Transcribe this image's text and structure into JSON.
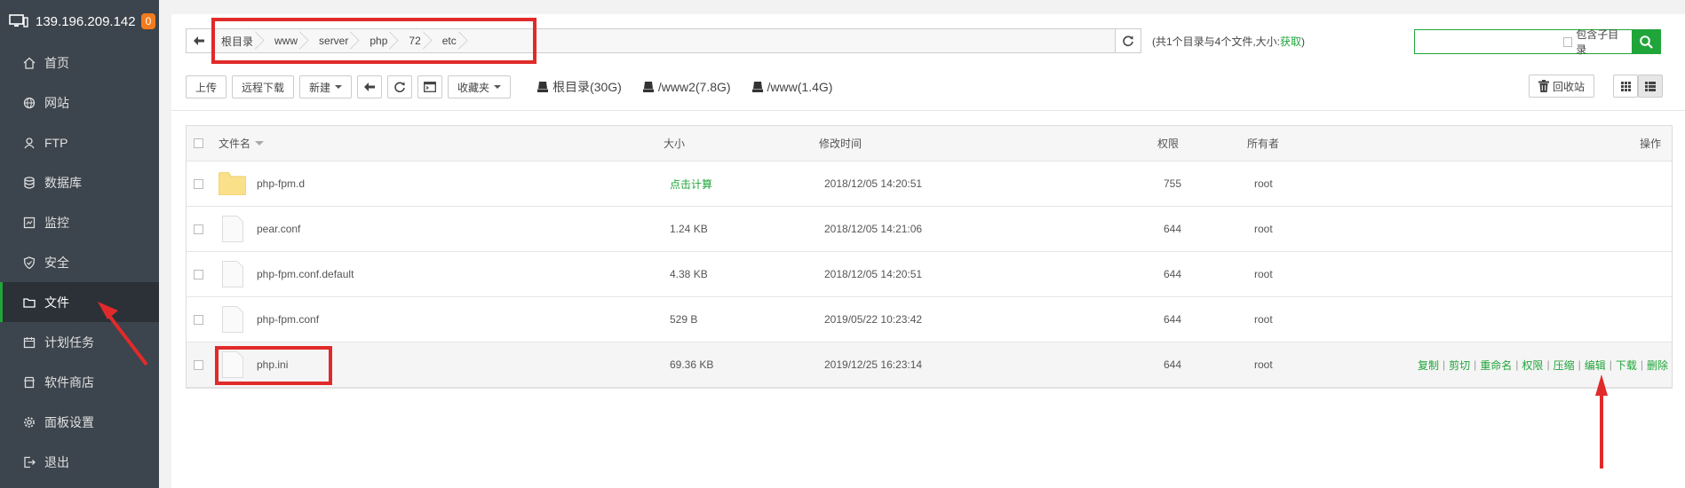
{
  "sidebar": {
    "ip": "139.196.209.142",
    "badge": "0",
    "items": [
      {
        "label": "首页",
        "icon": "home-icon"
      },
      {
        "label": "网站",
        "icon": "globe-icon"
      },
      {
        "label": "FTP",
        "icon": "ftp-icon"
      },
      {
        "label": "数据库",
        "icon": "database-icon"
      },
      {
        "label": "监控",
        "icon": "monitor-icon"
      },
      {
        "label": "安全",
        "icon": "shield-icon"
      },
      {
        "label": "文件",
        "icon": "folder-icon",
        "active": true
      },
      {
        "label": "计划任务",
        "icon": "calendar-icon"
      },
      {
        "label": "软件商店",
        "icon": "store-icon"
      },
      {
        "label": "面板设置",
        "icon": "gear-icon"
      },
      {
        "label": "退出",
        "icon": "logout-icon"
      }
    ]
  },
  "breadcrumb": [
    "根目录",
    "www",
    "server",
    "php",
    "72",
    "etc"
  ],
  "summary": {
    "text": "(共1个目录与4个文件,大小:",
    "link": "获取",
    "end": ")"
  },
  "search": {
    "placeholder": "",
    "sub_label": "包含子目录"
  },
  "toolbar": {
    "upload": "上传",
    "remote_download": "远程下载",
    "new": "新建",
    "favorites": "收藏夹",
    "disks": [
      "根目录(30G)",
      "/www2(7.8G)",
      "/www(1.4G)"
    ],
    "recycle": "回收站"
  },
  "table": {
    "headers": {
      "name": "文件名",
      "size": "大小",
      "mtime": "修改时间",
      "perm": "权限",
      "owner": "所有者",
      "ops": "操作"
    },
    "rows": [
      {
        "name": "php-fpm.d",
        "type": "folder",
        "size": "点击计算",
        "mtime": "2018/12/05 14:20:51",
        "perm": "755",
        "owner": "root"
      },
      {
        "name": "pear.conf",
        "type": "file",
        "size": "1.24 KB",
        "mtime": "2018/12/05 14:21:06",
        "perm": "644",
        "owner": "root"
      },
      {
        "name": "php-fpm.conf.default",
        "type": "file",
        "size": "4.38 KB",
        "mtime": "2018/12/05 14:20:51",
        "perm": "644",
        "owner": "root"
      },
      {
        "name": "php-fpm.conf",
        "type": "file",
        "size": "529 B",
        "mtime": "2019/05/22 10:23:42",
        "perm": "644",
        "owner": "root"
      },
      {
        "name": "php.ini",
        "type": "file",
        "size": "69.36 KB",
        "mtime": "2019/12/25 16:23:14",
        "perm": "644",
        "owner": "root",
        "highlight": true
      }
    ],
    "ops": [
      "复制",
      "剪切",
      "重命名",
      "权限",
      "压缩",
      "编辑",
      "下载",
      "删除"
    ]
  },
  "colors": {
    "sidebar": "#3c444d",
    "accent": "#20a53a",
    "annotation": "#e12a2a",
    "folder": "#fce38a"
  }
}
